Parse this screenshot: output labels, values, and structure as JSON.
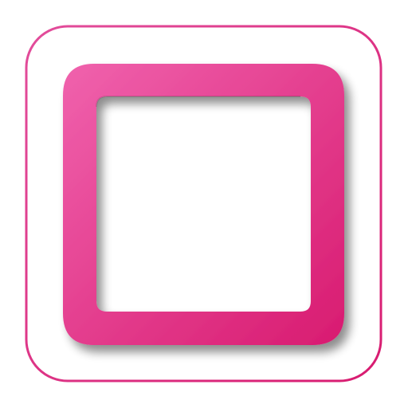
{
  "icon": {
    "name": "rounded-square-outline-icon",
    "colors": {
      "background": "#ffffff",
      "outer_border": "#df3e93",
      "gradient_start": "#f062ad",
      "gradient_end": "#d81b70",
      "inner_fill": "#ffffff",
      "shadow": "#000000"
    }
  }
}
